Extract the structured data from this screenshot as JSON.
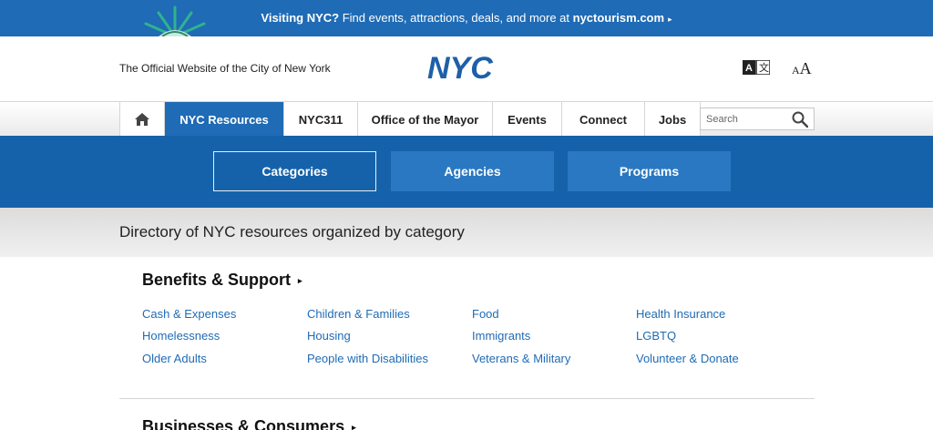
{
  "banner": {
    "lead": "Visiting NYC?",
    "text": " Find events, attractions, deals, and more at ",
    "link": "nyctourism.com",
    "arrow": "▸"
  },
  "header": {
    "official": "The Official Website of the City of New York",
    "logo_text": "NYC",
    "translate_icon": "translate-icon",
    "text_size_small": "A",
    "text_size_big": "A"
  },
  "nav": {
    "home_icon": "home-icon",
    "items": [
      {
        "label": "NYC Resources",
        "active": true
      },
      {
        "label": "NYC311",
        "active": false
      },
      {
        "label": "Office of the Mayor",
        "active": false
      },
      {
        "label": "Events",
        "active": false
      },
      {
        "label": "Connect",
        "active": false
      },
      {
        "label": "Jobs",
        "active": false
      }
    ],
    "search_placeholder": "Search"
  },
  "tabs": [
    {
      "label": "Categories",
      "active": true
    },
    {
      "label": "Agencies",
      "active": false
    },
    {
      "label": "Programs",
      "active": false
    }
  ],
  "directory_heading": "Directory of NYC resources organized by category",
  "sections": [
    {
      "title": "Benefits & Support",
      "arrow": "▸",
      "links": [
        "Cash & Expenses",
        "Children & Families",
        "Food",
        "Health Insurance",
        "Homelessness",
        "Housing",
        "Immigrants",
        "LGBTQ",
        "Older Adults",
        "People with Disabilities",
        "Veterans & Military",
        "Volunteer & Donate"
      ]
    },
    {
      "title": "Businesses & Consumers",
      "arrow": "▸"
    }
  ],
  "colors": {
    "brand_blue": "#1f6bb5",
    "tab_strip": "#1562aa",
    "link": "#1f6bb5"
  }
}
